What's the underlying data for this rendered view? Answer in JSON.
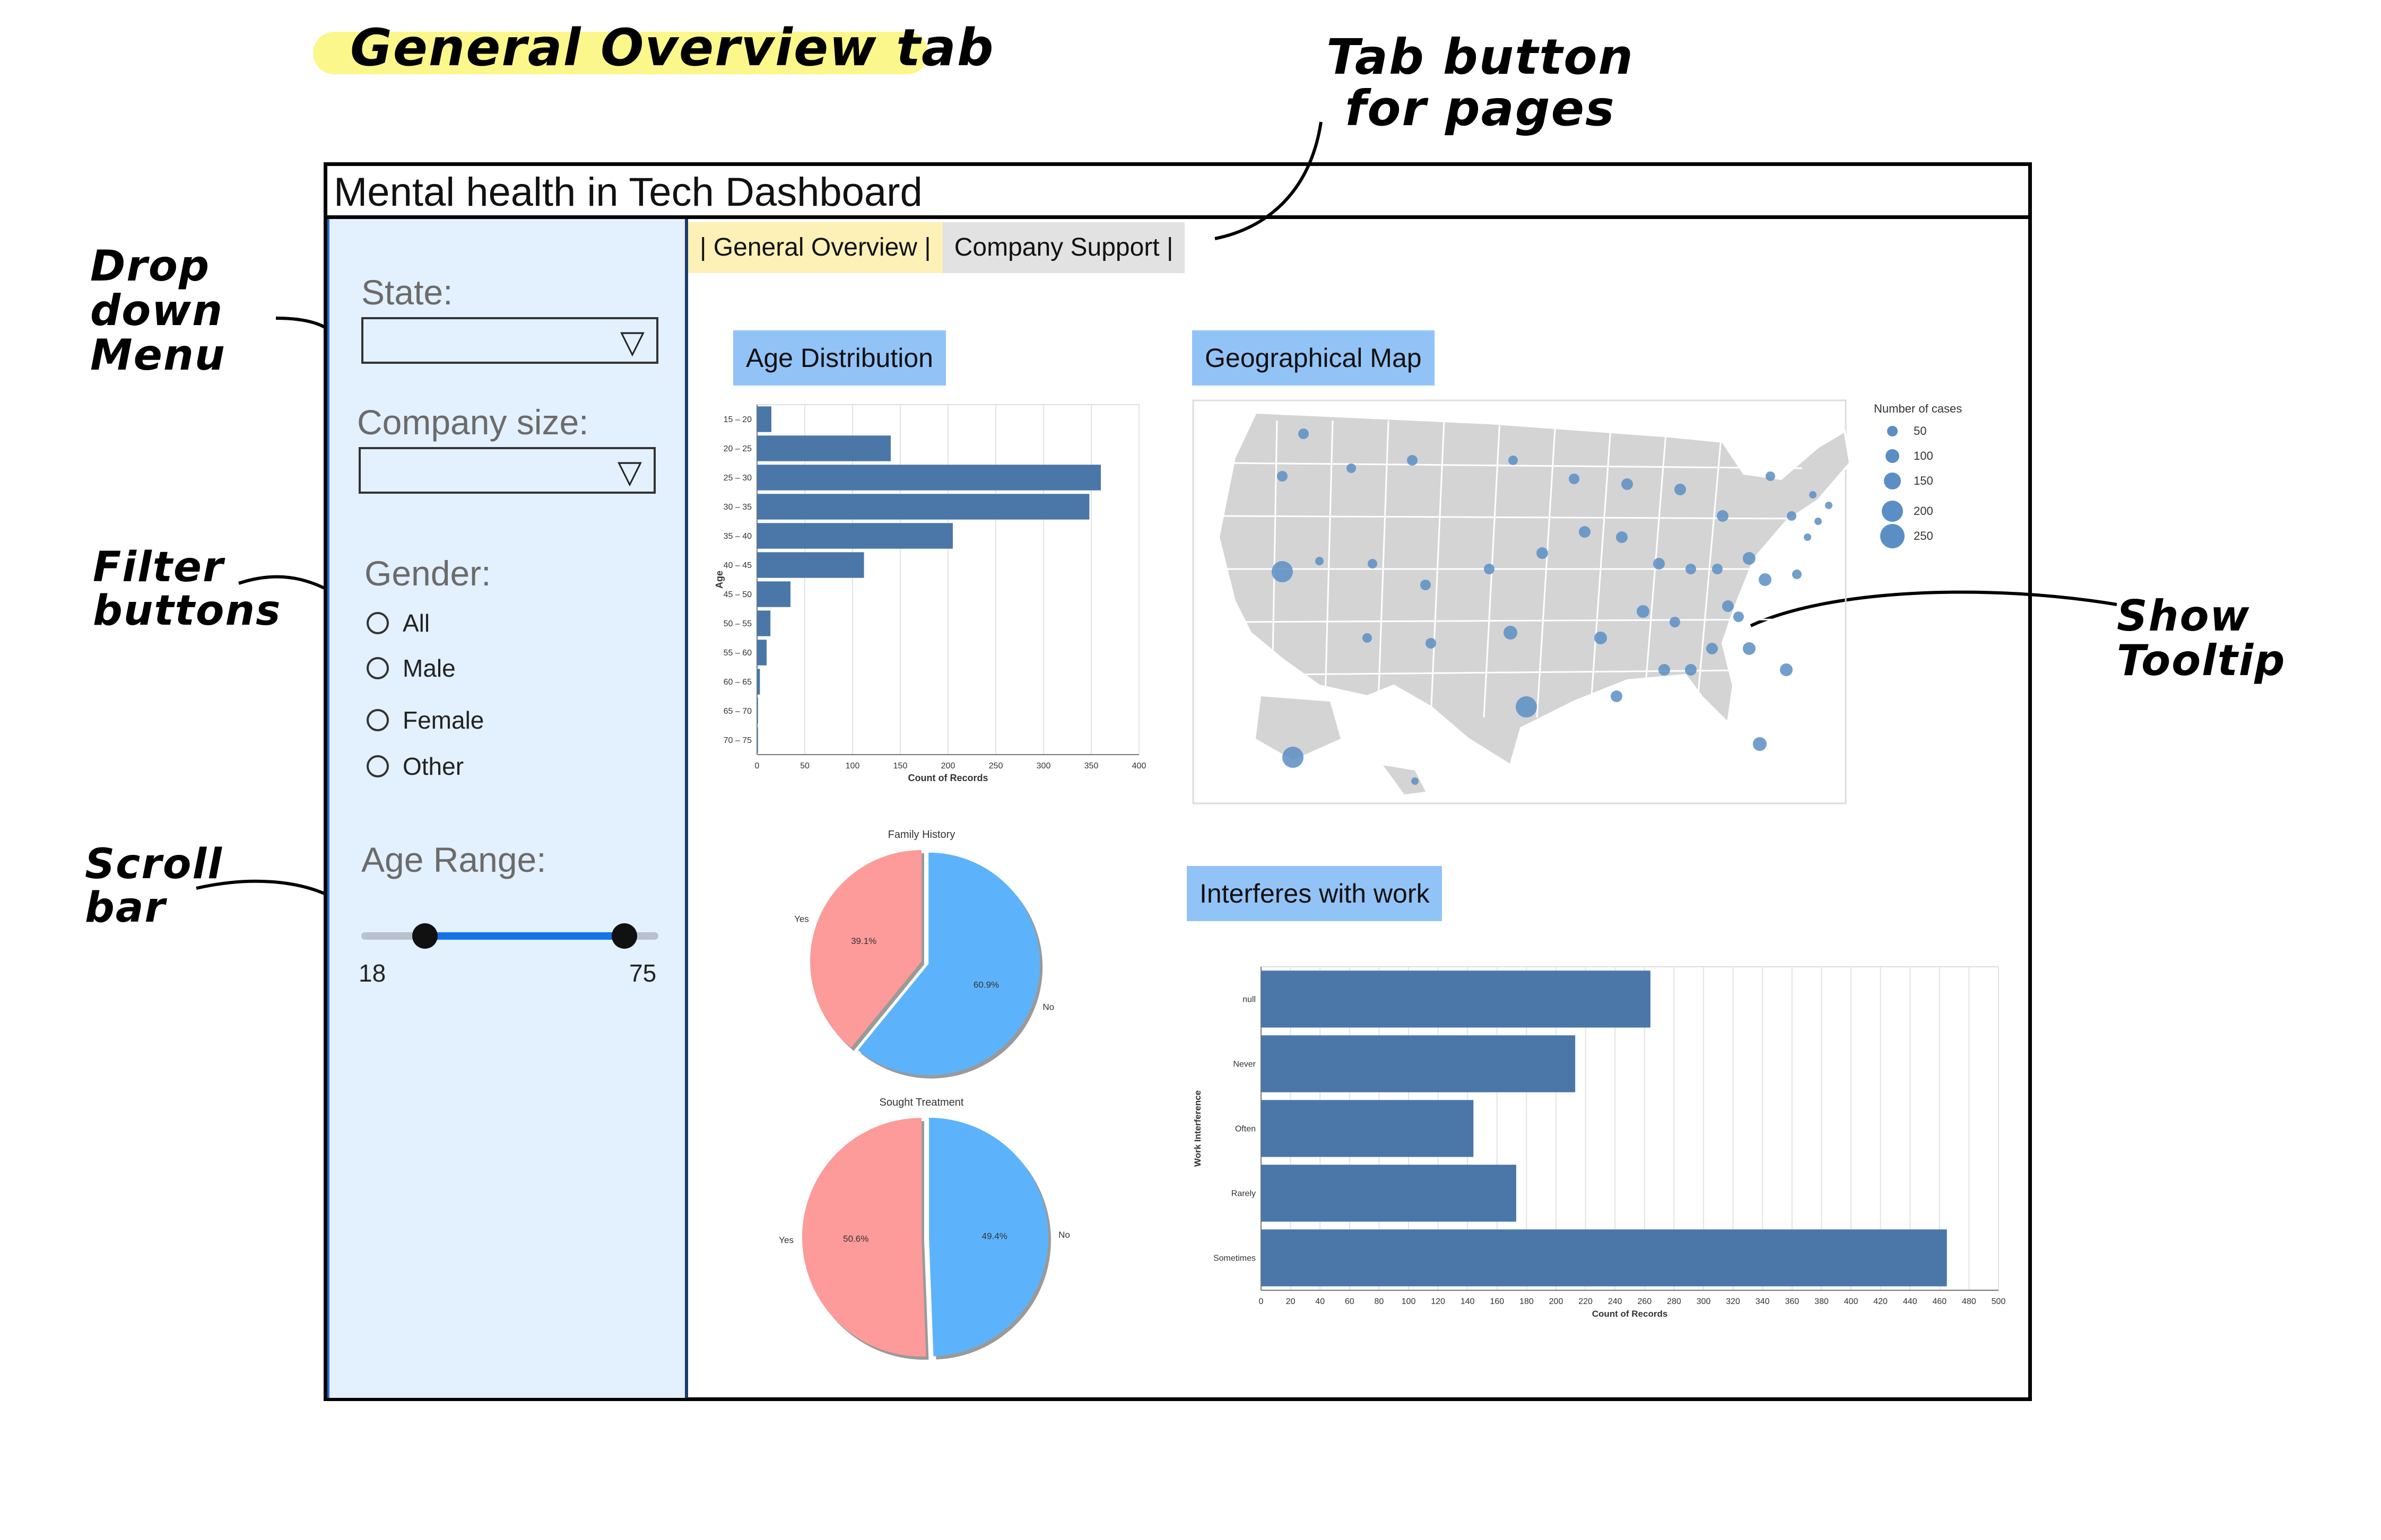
{
  "annotations": {
    "page_title": "General Overview tab",
    "tab_button_note": "Tab button for pages",
    "dropdown_note": "Drop down Menu",
    "filter_note": "Filter buttons",
    "scrollbar_note": "Scroll bar",
    "tooltip_note": "Show Tooltip"
  },
  "dashboard": {
    "title": "Mental health in Tech Dashboard",
    "tabs": [
      {
        "label": "| General Overview |",
        "active": true
      },
      {
        "label": "Company Support |",
        "active": false
      }
    ]
  },
  "sidebar": {
    "state_label": "State:",
    "state_value": "",
    "company_size_label": "Company size:",
    "company_size_value": "",
    "gender_label": "Gender:",
    "gender_options": [
      "All",
      "Male",
      "Female",
      "Other"
    ],
    "age_label": "Age Range:",
    "age_min": "18",
    "age_max": "75",
    "dropdown_arrow": "▽"
  },
  "colors": {
    "bar": "#4a77a8",
    "yes_slice": "#fd9a9a",
    "no_slice": "#5db3fb",
    "chip": "#92c3f7",
    "sidebar_bg": "#e3f0fd",
    "active_tab": "#fdf1b7",
    "map_land": "#d4d4d4",
    "map_dot": "#5b8ec4"
  },
  "panels": {
    "age_distribution": "Age Distribution",
    "geo_map": "Geographical Map",
    "interferes": "Interferes with work"
  },
  "chart_data": [
    {
      "type": "bar",
      "orientation": "horizontal",
      "categories": [
        "15 – 20",
        "20 – 25",
        "25 – 30",
        "30 – 35",
        "35 – 40",
        "40 – 45",
        "45 – 50",
        "50 – 55",
        "55 – 60",
        "60 – 65",
        "65 – 70",
        "70 – 75"
      ],
      "values": [
        15,
        140,
        360,
        348,
        205,
        112,
        35,
        14,
        10,
        3,
        1,
        1
      ],
      "xlabel": "Count of Records",
      "ylabel": "Age",
      "xlim": [
        0,
        400
      ],
      "xticks": [
        0,
        50,
        100,
        150,
        200,
        250,
        300,
        350,
        400
      ],
      "grid": true
    },
    {
      "type": "pie",
      "title": "Family History",
      "labels": [
        "Yes",
        "No"
      ],
      "values": [
        39.1,
        60.9
      ],
      "value_labels": [
        "39.1%",
        "60.9%"
      ]
    },
    {
      "type": "pie",
      "title": "Sought Treatment",
      "labels": [
        "Yes",
        "No"
      ],
      "values": [
        50.6,
        49.4
      ],
      "value_labels": [
        "50.6%",
        "49.4%"
      ]
    },
    {
      "type": "bar",
      "orientation": "horizontal",
      "categories": [
        "null",
        "Never",
        "Often",
        "Rarely",
        "Sometimes"
      ],
      "values": [
        264,
        213,
        144,
        173,
        465
      ],
      "xlabel": "Count of Records",
      "ylabel": "Work Interference",
      "xlim": [
        0,
        500
      ],
      "xticks": [
        0,
        20,
        40,
        60,
        80,
        100,
        120,
        140,
        160,
        180,
        200,
        220,
        240,
        260,
        280,
        300,
        320,
        340,
        360,
        380,
        400,
        420,
        440,
        460,
        480,
        500
      ],
      "grid": true
    },
    {
      "type": "scatter",
      "kind": "bubble-map",
      "legend_title": "Number of cases",
      "legend_values": [
        "50",
        "100",
        "150",
        "200",
        "250"
      ],
      "legend_placement": "top-right"
    }
  ]
}
